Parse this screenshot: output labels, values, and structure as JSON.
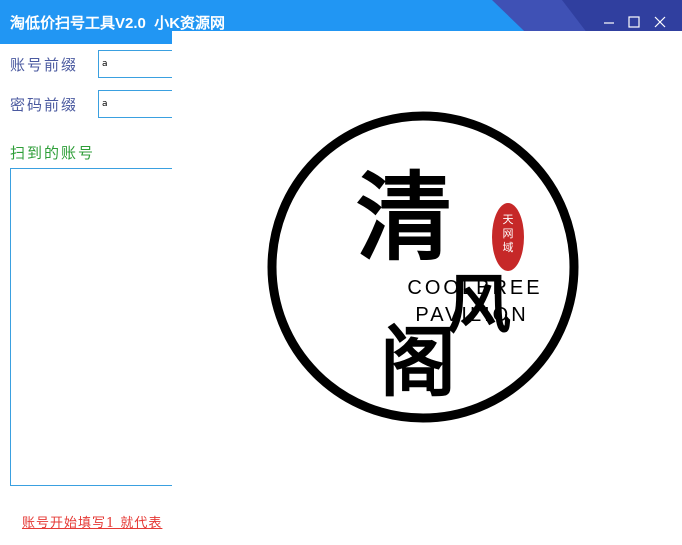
{
  "window": {
    "title": "淘低价扫号工具V2.0  小K资源网",
    "minimize_icon": "minimize-icon",
    "maximize_icon": "maximize-icon",
    "close_icon": "close-icon"
  },
  "form": {
    "account_prefix_label": "账号前缀",
    "account_prefix_value": "a",
    "password_prefix_label": "密码前缀",
    "password_prefix_value": "a"
  },
  "results": {
    "label": "扫到的账号",
    "value": ""
  },
  "hint": {
    "text": "账号开始填写1 就代表"
  },
  "logo": {
    "big_char_top": "清",
    "big_char_right": "风",
    "big_char_bottom": "阁",
    "english_line1": "COOLBREE",
    "english_line2": "PAVILION",
    "seal_text": "天网域",
    "seal_color": "#c62828",
    "ring_color": "#000000"
  },
  "colors": {
    "titlebar": "#2196f3",
    "titlebar_accent": "#3f51b5",
    "input_border": "#3aa0e0",
    "label_blue": "#4b5aa0",
    "label_green": "#2e9e38",
    "hint_red": "#e53935"
  }
}
